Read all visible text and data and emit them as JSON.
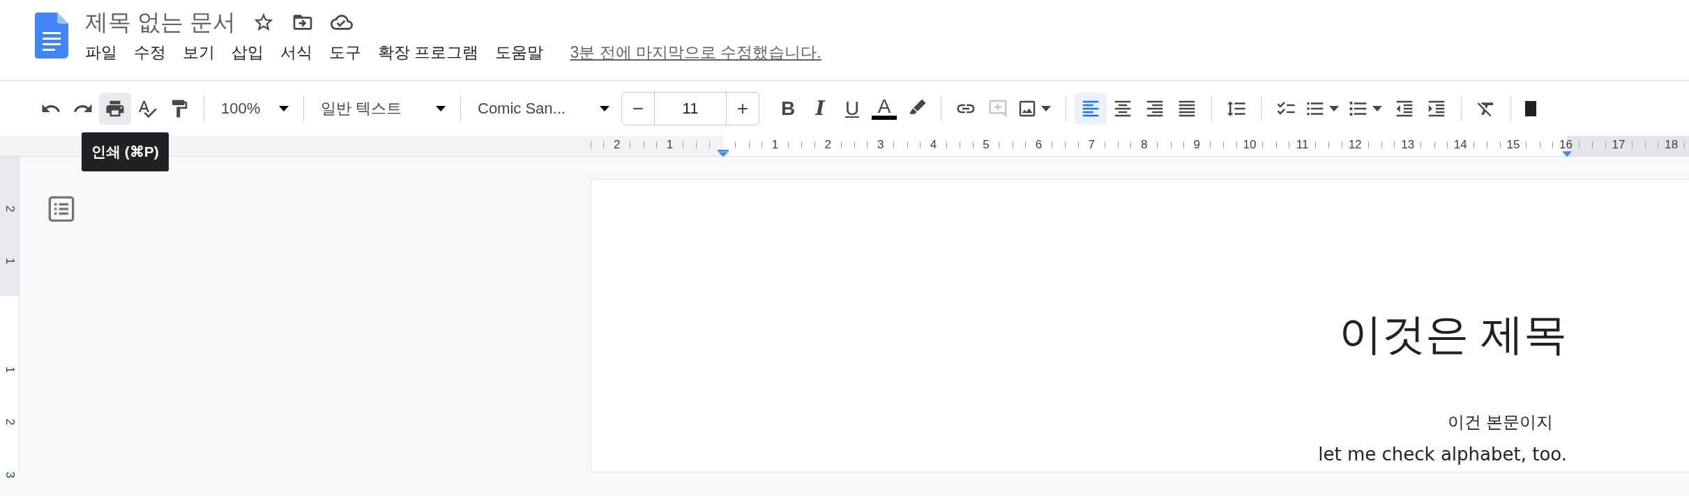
{
  "document": {
    "title": "제목 없는 문서",
    "status": "3분 전에 마지막으로 수정했습니다."
  },
  "menu": [
    "파일",
    "수정",
    "보기",
    "삽입",
    "서식",
    "도구",
    "확장 프로그램",
    "도움말"
  ],
  "toolbar": [
    [
      {
        "kind": "undo"
      },
      {
        "kind": "redo"
      },
      {
        "kind": "print",
        "hovered": true
      },
      {
        "kind": "spellcheck"
      },
      {
        "kind": "paint_format"
      }
    ],
    [
      {
        "kind": "zoom",
        "value": "100%"
      }
    ],
    [
      {
        "kind": "style",
        "value": "일반 텍스트"
      }
    ],
    [
      {
        "kind": "font",
        "value": "Comic San..."
      },
      {
        "kind": "stepper",
        "minus": "−",
        "value": "11",
        "plus": "+"
      },
      {
        "kind": "bold",
        "label": "B"
      },
      {
        "kind": "italic",
        "label": "I"
      },
      {
        "kind": "underline",
        "label": "U"
      },
      {
        "kind": "text_color",
        "label": "A",
        "color": "#000000"
      },
      {
        "kind": "highlight"
      }
    ],
    [
      {
        "kind": "link"
      },
      {
        "kind": "comment",
        "disabled": true
      },
      {
        "kind": "image",
        "caret": true
      }
    ],
    [
      {
        "kind": "align_left",
        "selected": true
      },
      {
        "kind": "align_center",
        "selected": false
      },
      {
        "kind": "align_right",
        "selected": false
      },
      {
        "kind": "justify",
        "selected": false
      }
    ],
    [
      {
        "kind": "line_spacing"
      }
    ],
    [
      {
        "kind": "checklist"
      },
      {
        "kind": "bullets",
        "caret": true
      },
      {
        "kind": "numbered",
        "caret": true
      },
      {
        "kind": "outdent"
      },
      {
        "kind": "indent"
      }
    ],
    [
      {
        "kind": "clear_format"
      }
    ],
    [
      {
        "kind": "partial"
      }
    ]
  ],
  "tooltip": {
    "text": "인쇄 (⌘P)"
  },
  "ruler": {
    "left_marks": [
      "2",
      "1"
    ],
    "marks": [
      "1",
      "2",
      "3",
      "4",
      "5",
      "6",
      "7",
      "8",
      "9",
      "10",
      "11",
      "12",
      "13",
      "14",
      "15",
      "16",
      "17",
      "18"
    ]
  },
  "vertical_ruler": {
    "marks": [
      "2",
      "1",
      "1",
      "2",
      "3"
    ]
  },
  "page": {
    "paragraphs": [
      {
        "kind": "title",
        "text": "이것은 제목"
      },
      {
        "kind": "body",
        "text": "이건 본문이지"
      },
      {
        "kind": "comic",
        "text": "let me check alphabet, too."
      }
    ]
  }
}
